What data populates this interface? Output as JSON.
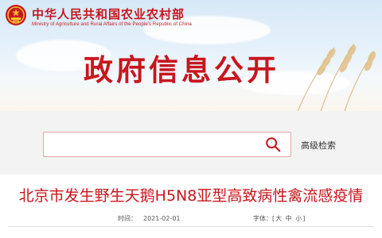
{
  "header": {
    "site_title": "中华人民共和国农业农村部",
    "site_subtitle": "Ministry of Agriculture and Rural Affairs of the People's Republic of China",
    "banner_heading": "政府信息公开"
  },
  "search": {
    "value": "",
    "placeholder": "",
    "advanced_label": "高级检索"
  },
  "article": {
    "title": "北京市发生野生天鹅H5N8亚型高致病性禽流感疫情",
    "date_label": "时间：",
    "date": "2021-02-01",
    "font_label": "字体：",
    "font_open": "[",
    "font_large": "大",
    "font_medium": "中",
    "font_small": "小",
    "font_close": "]"
  },
  "colors": {
    "brand_red": "#c8161d",
    "search_band": "#f3f3f3"
  },
  "icons": {
    "emblem": "national-emblem-icon",
    "search": "search-icon"
  }
}
